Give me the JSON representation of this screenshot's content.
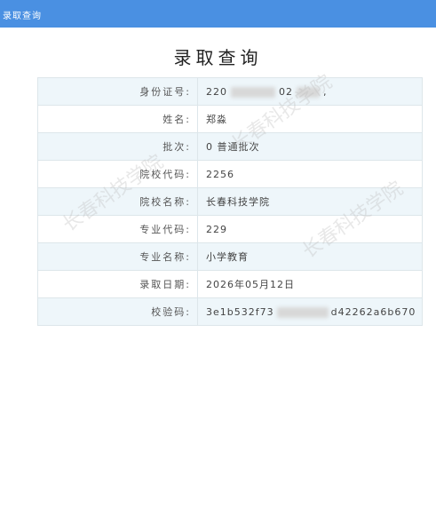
{
  "window": {
    "title": "录取查询"
  },
  "page": {
    "title": "录取查询"
  },
  "rows": [
    {
      "label": "身份证号:",
      "value_parts": [
        "220",
        "02",
        ","
      ],
      "masked": true
    },
    {
      "label": "姓名:",
      "value": "郑淼"
    },
    {
      "label": "批次:",
      "value": "0 普通批次"
    },
    {
      "label": "院校代码:",
      "value": "2256"
    },
    {
      "label": "院校名称:",
      "value": "长春科技学院"
    },
    {
      "label": "专业代码:",
      "value": "229"
    },
    {
      "label": "专业名称:",
      "value": "小学教育"
    },
    {
      "label": "录取日期:",
      "value": "2026年05月12日"
    },
    {
      "label": "校验码:",
      "value_parts": [
        "3e1b532f73",
        "d42262a6b670"
      ],
      "masked": true
    }
  ],
  "watermark_text": "长春科技学院",
  "colors": {
    "topbar": "#4a90e2",
    "row_alt": "#eef6fa",
    "border": "#dde6ea"
  }
}
